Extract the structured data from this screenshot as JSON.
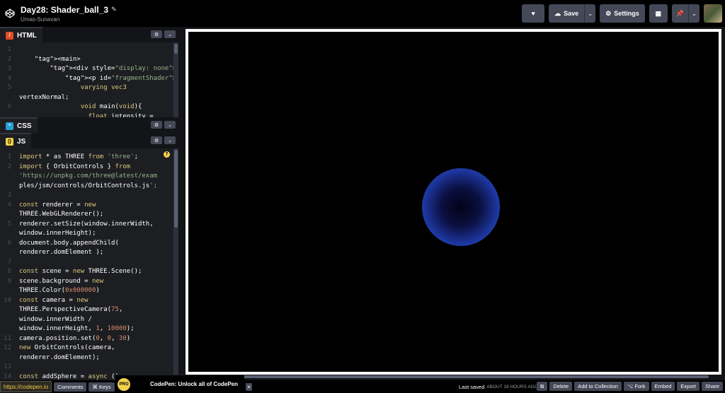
{
  "header": {
    "title": "Day28: Shader_ball_3",
    "author": "Umas-Sunavan",
    "buttons": {
      "like_icon": "heart-icon",
      "save": "Save",
      "settings": "Settings"
    }
  },
  "editors": {
    "html": {
      "label": "HTML",
      "lines": [
        {
          "n": "1",
          "text": ""
        },
        {
          "n": "2",
          "text": "    <main>"
        },
        {
          "n": "3",
          "text": "        <div style=\"display: none\">"
        },
        {
          "n": "4",
          "text": "            <p id=\"fragmentShader\">"
        },
        {
          "n": "5",
          "text": "                varying vec3"
        },
        {
          "n": "",
          "text": "vertexNormal;"
        },
        {
          "n": "6",
          "text": "                void main(void){"
        },
        {
          "n": "",
          "text": "                  float intensity ="
        }
      ]
    },
    "css": {
      "label": "CSS"
    },
    "js": {
      "label": "JS",
      "lines": [
        {
          "n": "1",
          "text": "import * as THREE from 'three';"
        },
        {
          "n": "2",
          "text": "import { OrbitControls } from"
        },
        {
          "n": "",
          "text": "'https://unpkg.com/three@latest/exam"
        },
        {
          "n": "",
          "text": "ples/jsm/controls/OrbitControls.js';"
        },
        {
          "n": "3",
          "text": ""
        },
        {
          "n": "4",
          "text": "const renderer = new"
        },
        {
          "n": "",
          "text": "THREE.WebGLRenderer();"
        },
        {
          "n": "5",
          "text": "renderer.setSize(window.innerWidth,"
        },
        {
          "n": "",
          "text": "window.innerHeight);"
        },
        {
          "n": "6",
          "text": "document.body.appendChild("
        },
        {
          "n": "",
          "text": "renderer.domElement );"
        },
        {
          "n": "7",
          "text": ""
        },
        {
          "n": "8",
          "text": "const scene = new THREE.Scene();"
        },
        {
          "n": "9",
          "text": "scene.background = new"
        },
        {
          "n": "",
          "text": "THREE.Color(0x000000)"
        },
        {
          "n": "10",
          "text": "const camera = new"
        },
        {
          "n": "",
          "text": "THREE.PerspectiveCamera(75,"
        },
        {
          "n": "",
          "text": "window.innerWidth /"
        },
        {
          "n": "",
          "text": "window.innerHeight, 1, 10000);"
        },
        {
          "n": "11",
          "text": "camera.position.set(0, 0, 30)"
        },
        {
          "n": "12",
          "text": "new OrbitControls(camera,"
        },
        {
          "n": "",
          "text": "renderer.domElement);"
        },
        {
          "n": "13",
          "text": ""
        },
        {
          "n": "14",
          "text": "const addSphere = async ()"
        }
      ]
    }
  },
  "footer": {
    "url": "https://codepen.io",
    "comments": "Comments",
    "keys": "⌘ Keys",
    "promo_badge": "PRO",
    "promo_text": "CodePen: Unlock all of CodePen",
    "last_saved": "Last saved",
    "last_saved_time": "ABOUT 18 HOURS AGO",
    "delete": "Delete",
    "add_to_collection": "Add to Collection",
    "fork": "⌥ Fork",
    "embed": "Embed",
    "export": "Export",
    "share": "Share"
  },
  "colors": {
    "header_bg": "#000000",
    "editor_bg": "#1d1e22",
    "button_bg": "#444857",
    "html_icon": "#e34c26",
    "css_icon": "#2a9fd6",
    "js_icon": "#f2d24b",
    "ball_edge": "#4b78ff"
  }
}
